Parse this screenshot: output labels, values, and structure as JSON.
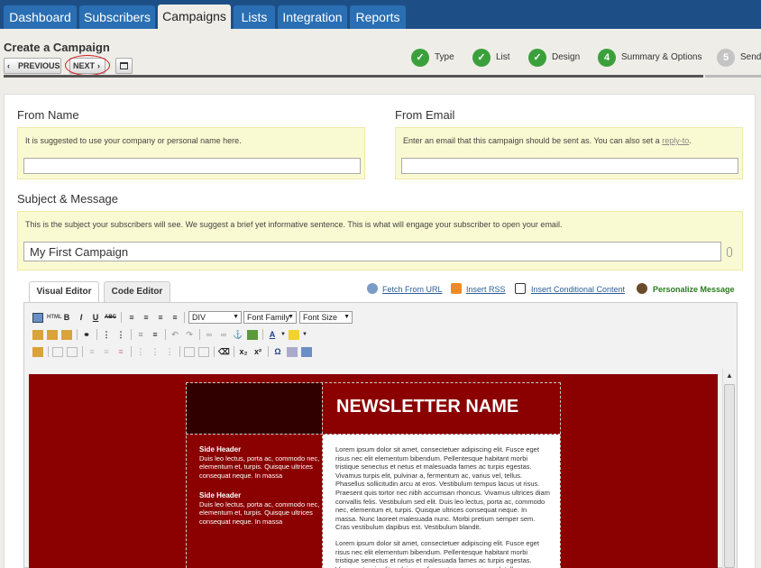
{
  "nav": {
    "tabs": [
      {
        "label": "Dashboard"
      },
      {
        "label": "Subscribers"
      },
      {
        "label": "Campaigns"
      },
      {
        "label": "Lists"
      },
      {
        "label": "Integration"
      },
      {
        "label": "Reports"
      }
    ],
    "active_tab": "Campaigns"
  },
  "header": {
    "title": "Create a Campaign",
    "prev_label": "PREVIOUS",
    "next_label": "NEXT"
  },
  "steps": [
    {
      "num": "✓",
      "label": "Type",
      "status": "done"
    },
    {
      "num": "✓",
      "label": "List",
      "status": "done"
    },
    {
      "num": "✓",
      "label": "Design",
      "status": "done"
    },
    {
      "num": "4",
      "label": "Summary & Options",
      "status": "current"
    },
    {
      "num": "5",
      "label": "Send",
      "status": "pending"
    }
  ],
  "form": {
    "from_name_label": "From Name",
    "from_name_hint": "It is suggested to use your company or personal name here.",
    "from_name_value": "",
    "from_email_label": "From Email",
    "from_email_hint": "Enter an email that this campaign should be sent as. You can also set a",
    "from_email_link": "reply-to",
    "from_email_value": "",
    "subject_label": "Subject & Message",
    "subject_hint": "This is the subject your subscribers will see. We suggest a brief yet informative sentence. This is what will engage your subscriber to open your email.",
    "subject_value": "My First Campaign"
  },
  "editor": {
    "tab_visual": "Visual Editor",
    "tab_code": "Code Editor",
    "fetch_url": "Fetch From URL",
    "insert_rss": "Insert RSS",
    "insert_conditional": "Insert Conditional Content",
    "personalize": "Personalize Message",
    "format_select": "DIV",
    "font_family": "Font Family",
    "font_size": "Font Size"
  },
  "newsletter": {
    "title": "NEWSLETTER NAME",
    "side_header_1": "Side Header",
    "side_text_1": "Duis leo lectus, porta ac, commodo nec, elementum et, turpis. Quisque ultrices consequat neque. In massa",
    "side_header_2": "Side Header",
    "side_text_2": "Duis leo lectus, porta ac, commodo nec, elementum et, turpis. Quisque ultrices consequat neque. In massa",
    "body_1": "Lorem ipsum dolor sit amet, consectetuer adipiscing elit. Fusce eget risus nec elit elementum bibendum. Pellentesque habitant morbi tristique senectus et netus et malesuada fames ac turpis egestas. Vivamus turpis elit, pulvinar a, fermentum ac, varius vel, tellus. Phasellus sollicitudin arcu at eros. Vestibulum tempus lacus ut risus. Praesent quis tortor nec nibh accumsan rhoncus. Vivamus ultrices diam convallis felis. Vestibulum sed elit. Duis leo lectus, porta ac, commodo nec, elementum et, turpis. Quisque ultrices consequat neque. In massa. Nunc laoreet malesuada nunc. Morbi pretium semper sem. Cras vestibulum dapibus est. Vestibulum blandit.",
    "body_2": "Lorem ipsum dolor sit amet, consectetuer adipiscing elit. Fusce eget risus nec elit elementum bibendum. Pellentesque habitant morbi tristique senectus et netus et malesuada fames ac turpis egestas. Vivamus turpis elit, pulvinar a, fermentum ac, varius vel, tellus."
  },
  "colors": {
    "nav_bg": "#1d4f86",
    "tab": "#2a6fb3",
    "step_done": "#3ba03b",
    "newsletter_bg": "#8b0000",
    "newsletter_dark": "#300000",
    "annotation": "#d02020"
  }
}
